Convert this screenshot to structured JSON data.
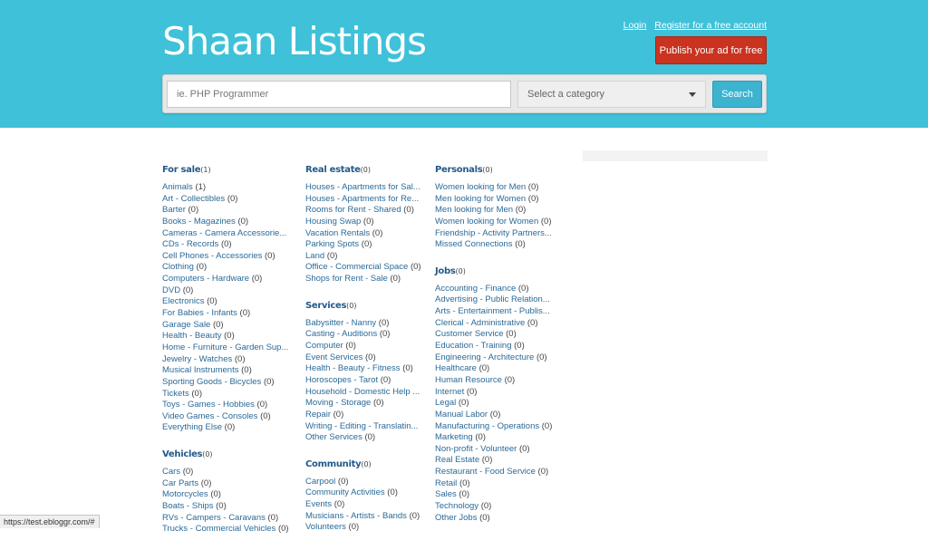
{
  "header": {
    "logo": "Shaan Listings",
    "login": "Login",
    "register": "Register for a free account",
    "publish": "Publish your ad for free"
  },
  "search": {
    "placeholder": "ie. PHP Programmer",
    "category_selected": "Select a category",
    "button": "Search"
  },
  "categories": {
    "for_sale": {
      "title": "For sale",
      "count": "(1)",
      "items": [
        {
          "label": "Animals",
          "count": "(1)"
        },
        {
          "label": "Art - Collectibles",
          "count": "(0)"
        },
        {
          "label": "Barter",
          "count": "(0)"
        },
        {
          "label": "Books - Magazines",
          "count": "(0)"
        },
        {
          "label": "Cameras - Camera Accessorie...",
          "count": ""
        },
        {
          "label": "CDs - Records",
          "count": "(0)"
        },
        {
          "label": "Cell Phones - Accessories",
          "count": "(0)"
        },
        {
          "label": "Clothing",
          "count": "(0)"
        },
        {
          "label": "Computers - Hardware",
          "count": "(0)"
        },
        {
          "label": "DVD",
          "count": "(0)"
        },
        {
          "label": "Electronics",
          "count": "(0)"
        },
        {
          "label": "For Babies - Infants",
          "count": "(0)"
        },
        {
          "label": "Garage Sale",
          "count": "(0)"
        },
        {
          "label": "Health - Beauty",
          "count": "(0)"
        },
        {
          "label": "Home - Furniture - Garden Sup...",
          "count": ""
        },
        {
          "label": "Jewelry - Watches",
          "count": "(0)"
        },
        {
          "label": "Musical Instruments",
          "count": "(0)"
        },
        {
          "label": "Sporting Goods - Bicycles",
          "count": "(0)"
        },
        {
          "label": "Tickets",
          "count": "(0)"
        },
        {
          "label": "Toys - Games - Hobbies",
          "count": "(0)"
        },
        {
          "label": "Video Games - Consoles",
          "count": "(0)"
        },
        {
          "label": "Everything Else",
          "count": "(0)"
        }
      ]
    },
    "vehicles": {
      "title": "Vehicles",
      "count": "(0)",
      "items": [
        {
          "label": "Cars",
          "count": "(0)"
        },
        {
          "label": "Car Parts",
          "count": "(0)"
        },
        {
          "label": "Motorcycles",
          "count": "(0)"
        },
        {
          "label": "Boats - Ships",
          "count": "(0)"
        },
        {
          "label": "RVs - Campers - Caravans",
          "count": "(0)"
        },
        {
          "label": "Trucks - Commercial Vehicles",
          "count": "(0)"
        }
      ]
    },
    "real_estate": {
      "title": "Real estate",
      "count": "(0)",
      "items": [
        {
          "label": "Houses - Apartments for Sal...",
          "count": ""
        },
        {
          "label": "Houses - Apartments for Re...",
          "count": ""
        },
        {
          "label": "Rooms for Rent - Shared",
          "count": "(0)"
        },
        {
          "label": "Housing Swap",
          "count": "(0)"
        },
        {
          "label": "Vacation Rentals",
          "count": "(0)"
        },
        {
          "label": "Parking Spots",
          "count": "(0)"
        },
        {
          "label": "Land",
          "count": "(0)"
        },
        {
          "label": "Office - Commercial Space",
          "count": "(0)"
        },
        {
          "label": "Shops for Rent - Sale",
          "count": "(0)"
        }
      ]
    },
    "services": {
      "title": "Services",
      "count": "(0)",
      "items": [
        {
          "label": "Babysitter - Nanny",
          "count": "(0)"
        },
        {
          "label": "Casting - Auditions",
          "count": "(0)"
        },
        {
          "label": "Computer",
          "count": "(0)"
        },
        {
          "label": "Event Services",
          "count": "(0)"
        },
        {
          "label": "Health - Beauty - Fitness",
          "count": "(0)"
        },
        {
          "label": "Horoscopes - Tarot",
          "count": "(0)"
        },
        {
          "label": "Household - Domestic Help ...",
          "count": ""
        },
        {
          "label": "Moving - Storage",
          "count": "(0)"
        },
        {
          "label": "Repair",
          "count": "(0)"
        },
        {
          "label": "Writing - Editing - Translatin...",
          "count": ""
        },
        {
          "label": "Other Services",
          "count": "(0)"
        }
      ]
    },
    "community": {
      "title": "Community",
      "count": "(0)",
      "items": [
        {
          "label": "Carpool",
          "count": "(0)"
        },
        {
          "label": "Community Activities",
          "count": "(0)"
        },
        {
          "label": "Events",
          "count": "(0)"
        },
        {
          "label": "Musicians - Artists - Bands",
          "count": "(0)"
        },
        {
          "label": "Volunteers",
          "count": "(0)"
        }
      ]
    },
    "personals": {
      "title": "Personals",
      "count": "(0)",
      "items": [
        {
          "label": "Women looking for Men",
          "count": "(0)"
        },
        {
          "label": "Men looking for Women",
          "count": "(0)"
        },
        {
          "label": "Men looking for Men",
          "count": "(0)"
        },
        {
          "label": "Women looking for Women",
          "count": "(0)"
        },
        {
          "label": "Friendship - Activity Partners...",
          "count": ""
        },
        {
          "label": "Missed Connections",
          "count": "(0)"
        }
      ]
    },
    "jobs": {
      "title": "Jobs",
      "count": "(0)",
      "items": [
        {
          "label": "Accounting - Finance",
          "count": "(0)"
        },
        {
          "label": "Advertising - Public Relation...",
          "count": ""
        },
        {
          "label": "Arts - Entertainment - Publis...",
          "count": ""
        },
        {
          "label": "Clerical - Administrative",
          "count": "(0)"
        },
        {
          "label": "Customer Service",
          "count": "(0)"
        },
        {
          "label": "Education - Training",
          "count": "(0)"
        },
        {
          "label": "Engineering - Architecture",
          "count": "(0)"
        },
        {
          "label": "Healthcare",
          "count": "(0)"
        },
        {
          "label": "Human Resource",
          "count": "(0)"
        },
        {
          "label": "Internet",
          "count": "(0)"
        },
        {
          "label": "Legal",
          "count": "(0)"
        },
        {
          "label": "Manual Labor",
          "count": "(0)"
        },
        {
          "label": "Manufacturing - Operations",
          "count": "(0)"
        },
        {
          "label": "Marketing",
          "count": "(0)"
        },
        {
          "label": "Non-profit - Volunteer",
          "count": "(0)"
        },
        {
          "label": "Real Estate",
          "count": "(0)"
        },
        {
          "label": "Restaurant - Food Service",
          "count": "(0)"
        },
        {
          "label": "Retail",
          "count": "(0)"
        },
        {
          "label": "Sales",
          "count": "(0)"
        },
        {
          "label": "Technology",
          "count": "(0)"
        },
        {
          "label": "Other Jobs",
          "count": "(0)"
        }
      ]
    }
  },
  "status_bar": {
    "url": "https://test.ebloggr.com/#"
  },
  "colors": {
    "header_bg": "#3ec1d9",
    "publish_button": "#c9331f",
    "search_button": "#3cb3cf",
    "category_title": "#235a8a",
    "link": "#2a6a98"
  }
}
